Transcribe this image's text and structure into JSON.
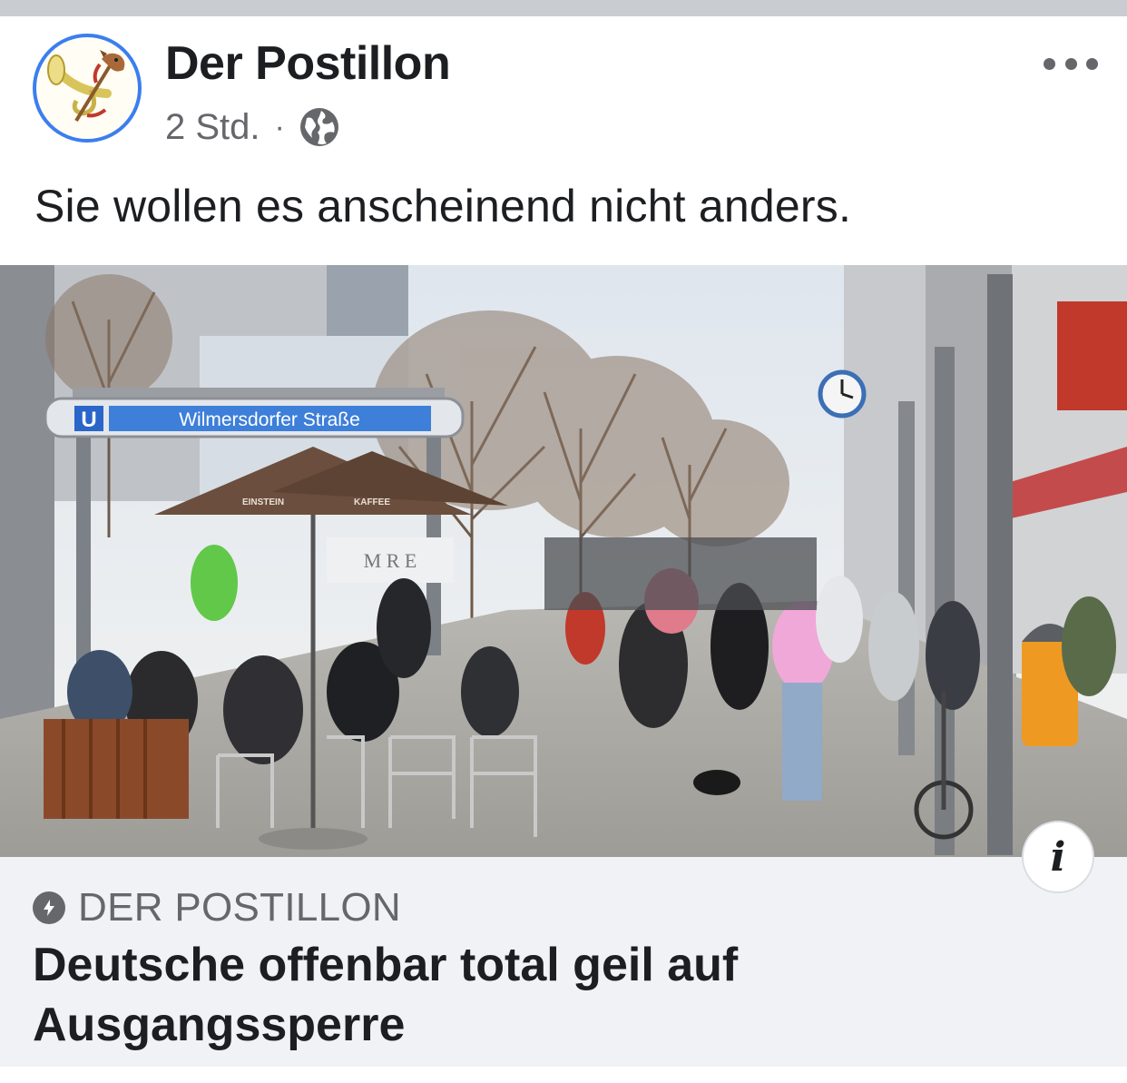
{
  "post": {
    "page_name": "Der Postillon",
    "time": "2 Std.",
    "separator": "·",
    "audience_icon": "globe-icon",
    "more_icon": "more-options-icon",
    "caption": "Sie wollen es anscheinend nicht anders."
  },
  "photo": {
    "station_letter": "U",
    "station_name": "Wilmersdorfer Straße",
    "umbrella_text_left": "EINSTEIN",
    "umbrella_text_right": "KAFFEE",
    "banner_text": "M R E"
  },
  "link": {
    "info_label": "i",
    "source": "DER POSTILLON",
    "headline_line1": "Deutsche offenbar total geil auf",
    "headline_line2": "Ausgangssperre"
  },
  "colors": {
    "accent_blue": "#3b7ef0",
    "text_primary": "#1c1e21",
    "text_secondary": "#65676b",
    "card_bg": "#f0f2f5"
  }
}
